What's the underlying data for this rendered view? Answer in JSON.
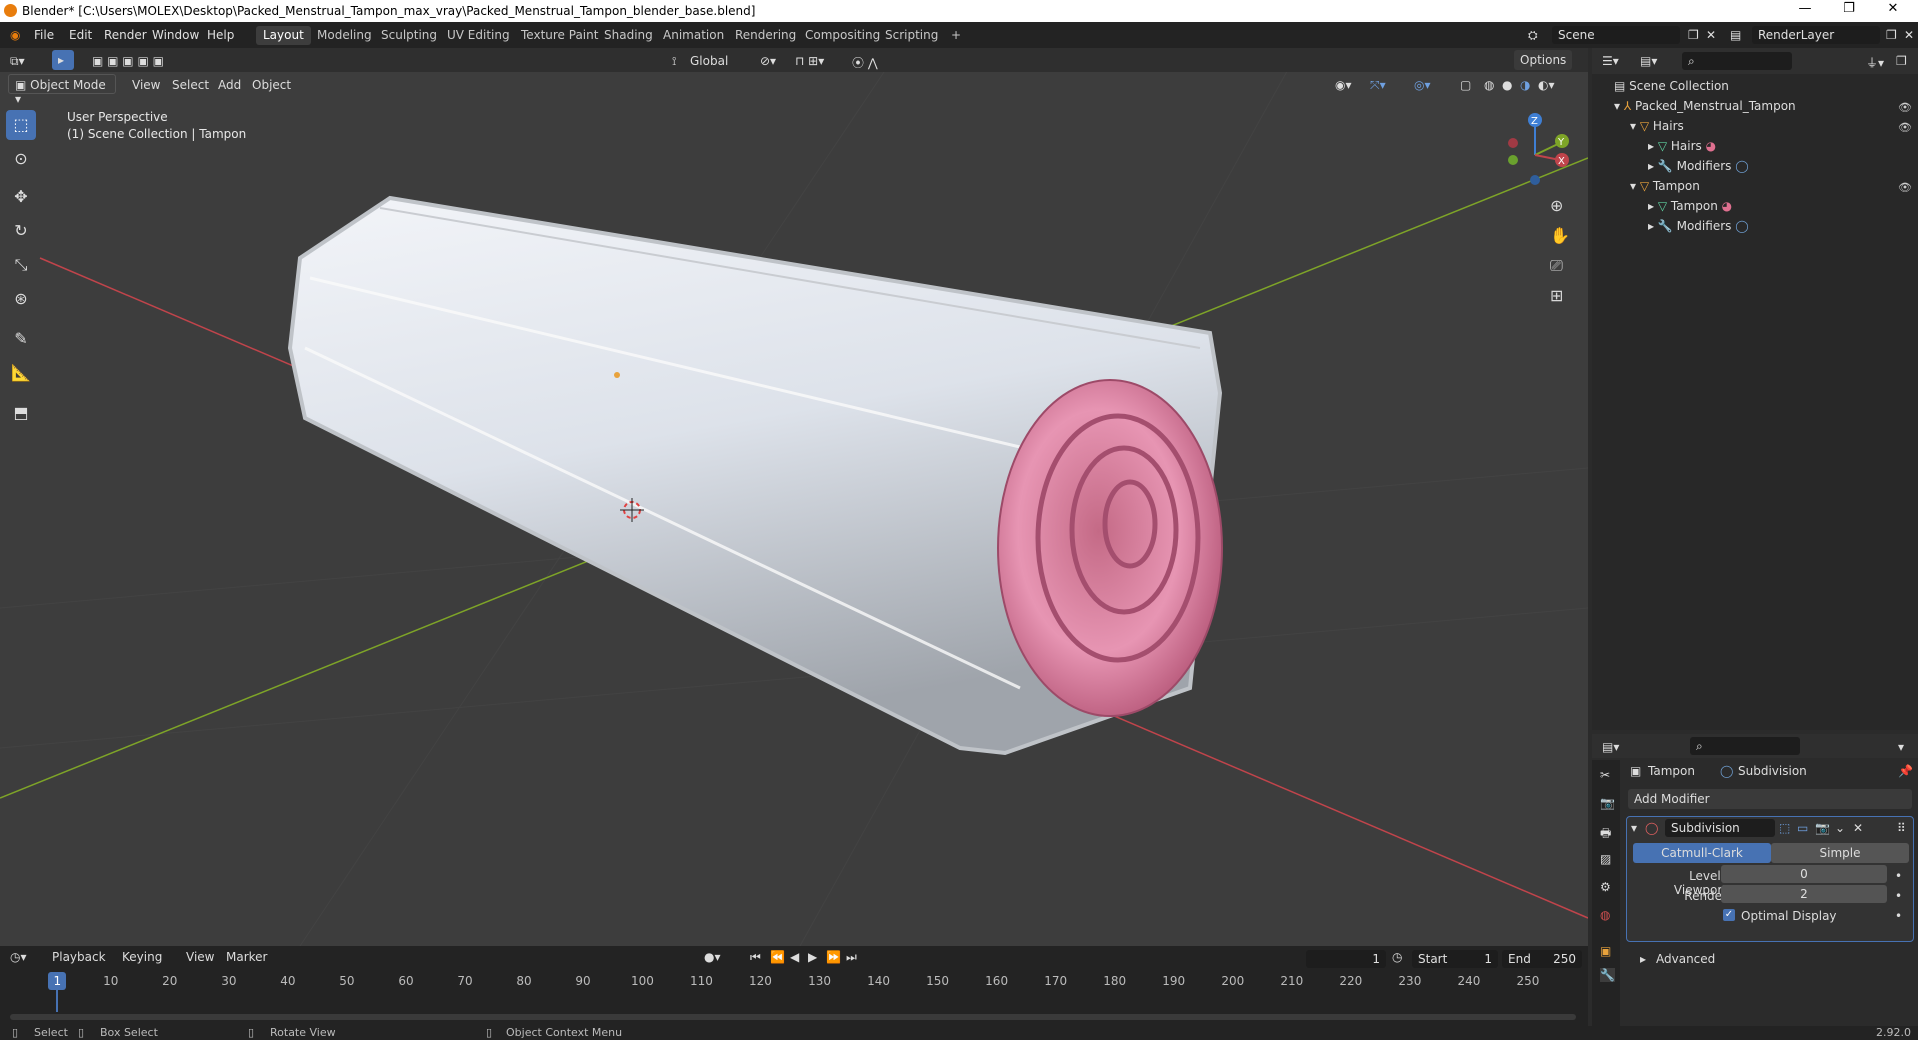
{
  "window": {
    "title": "Blender* [C:\\Users\\MOLEX\\Desktop\\Packed_Menstrual_Tampon_max_vray\\Packed_Menstrual_Tampon_blender_base.blend]",
    "controls": [
      "—",
      "❐",
      "✕"
    ]
  },
  "menu": [
    "File",
    "Edit",
    "Render",
    "Window",
    "Help"
  ],
  "workspaces": {
    "active": "Layout",
    "items": [
      "Layout",
      "Modeling",
      "Sculpting",
      "UV Editing",
      "Texture Paint",
      "Shading",
      "Animation",
      "Rendering",
      "Compositing",
      "Scripting"
    ],
    "add": "+"
  },
  "scene": {
    "label": "Scene",
    "render_layer": "RenderLayer"
  },
  "viewport_header": {
    "orientation": "Global",
    "options": "Options",
    "mode": "Object Mode",
    "menus": [
      "View",
      "Select",
      "Add",
      "Object"
    ]
  },
  "viewport": {
    "perspective": "User Perspective",
    "collection": "(1) Scene Collection | Tampon",
    "gizmo": {
      "z": "Z",
      "y": "Y",
      "x": "X"
    }
  },
  "outliner": {
    "root": "Scene Collection",
    "items": [
      {
        "label": "Packed_Menstrual_Tampon",
        "level": 1
      },
      {
        "label": "Hairs",
        "level": 2
      },
      {
        "label": "Hairs",
        "level": 3
      },
      {
        "label": "Modifiers",
        "level": 3
      },
      {
        "label": "Tampon",
        "level": 2
      },
      {
        "label": "Tampon",
        "level": 3
      },
      {
        "label": "Modifiers",
        "level": 3
      }
    ]
  },
  "properties": {
    "object": "Tampon",
    "modifier_crumb": "Subdivision",
    "add_modifier": "Add Modifier",
    "modifier_name": "Subdivision",
    "modes": [
      "Catmull-Clark",
      "Simple"
    ],
    "active_mode": "Catmull-Clark",
    "levels_viewport_label": "Levels Viewport",
    "levels_viewport": "0",
    "render_label": "Render",
    "render": "2",
    "optimal_display": "Optimal Display",
    "advanced": "Advanced"
  },
  "timeline": {
    "menus": [
      "Playback",
      "Keying",
      "View",
      "Marker"
    ],
    "current_frame": "1",
    "start_label": "Start",
    "start": "1",
    "end_label": "End",
    "end": "250",
    "ticks": [
      "1",
      "10",
      "20",
      "30",
      "40",
      "50",
      "60",
      "70",
      "80",
      "90",
      "100",
      "110",
      "120",
      "130",
      "140",
      "150",
      "160",
      "170",
      "180",
      "190",
      "200",
      "210",
      "220",
      "230",
      "240",
      "250"
    ]
  },
  "statusbar": {
    "select": "Select",
    "box_select": "Box Select",
    "rotate": "Rotate View",
    "context": "Object Context Menu",
    "version": "2.92.0"
  },
  "colors": {
    "accent": "#4772b3",
    "x_axis": "#c0444b",
    "y_axis": "#7ea428",
    "z_axis": "#3f7fd4"
  }
}
